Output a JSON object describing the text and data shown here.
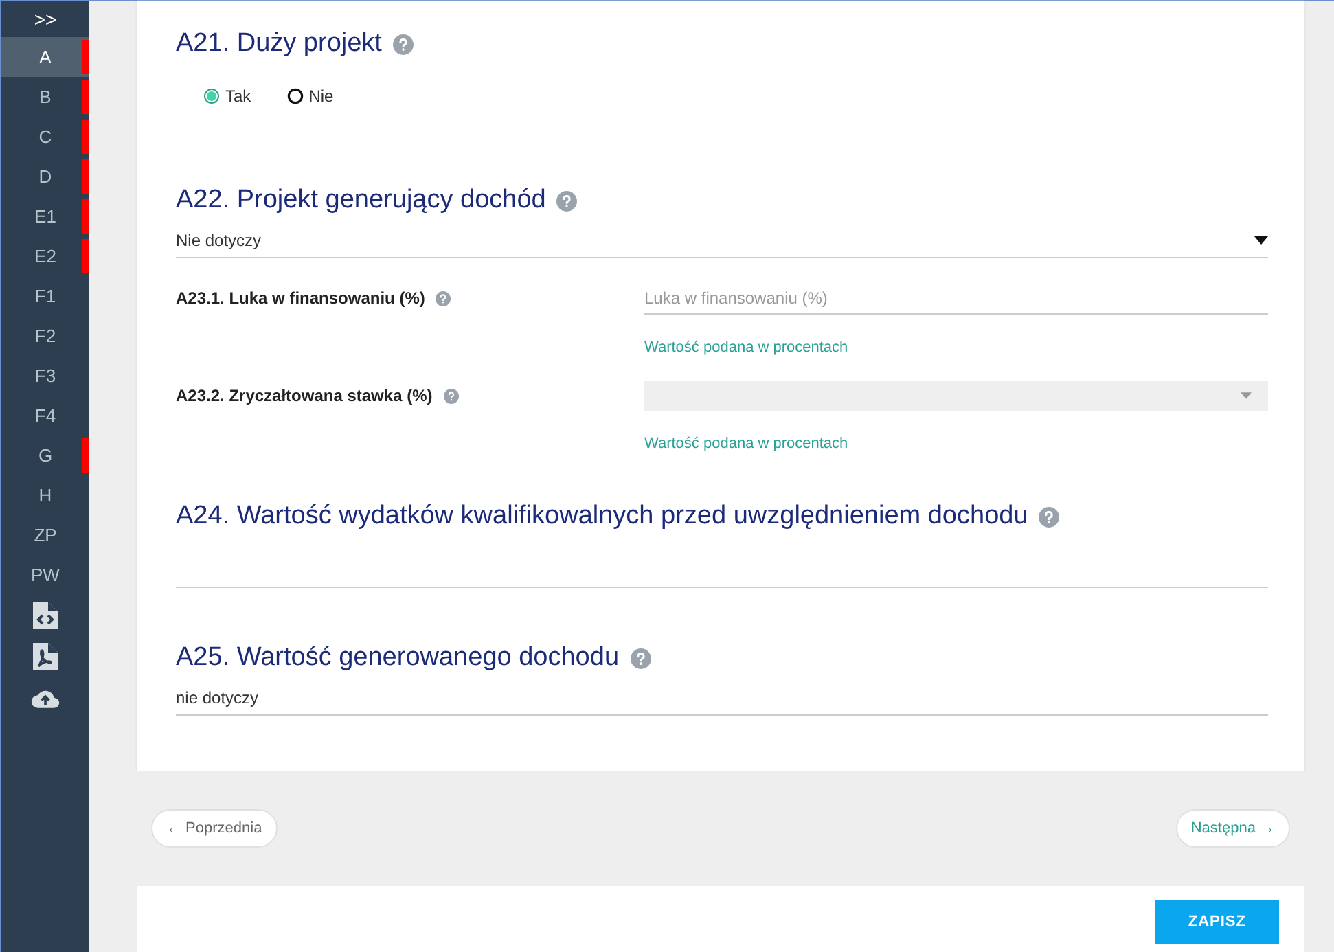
{
  "sidebar": {
    "toggle": ">>",
    "items": [
      {
        "label": "A",
        "selected": true,
        "flagged": true
      },
      {
        "label": "B",
        "selected": false,
        "flagged": true
      },
      {
        "label": "C",
        "selected": false,
        "flagged": true
      },
      {
        "label": "D",
        "selected": false,
        "flagged": true
      },
      {
        "label": "E1",
        "selected": false,
        "flagged": true
      },
      {
        "label": "E2",
        "selected": false,
        "flagged": true
      },
      {
        "label": "F1",
        "selected": false,
        "flagged": false
      },
      {
        "label": "F2",
        "selected": false,
        "flagged": false
      },
      {
        "label": "F3",
        "selected": false,
        "flagged": false
      },
      {
        "label": "F4",
        "selected": false,
        "flagged": false
      },
      {
        "label": "G",
        "selected": false,
        "flagged": true
      },
      {
        "label": "H",
        "selected": false,
        "flagged": false
      },
      {
        "label": "ZP",
        "selected": false,
        "flagged": false
      },
      {
        "label": "PW",
        "selected": false,
        "flagged": false
      }
    ]
  },
  "form": [
    {
      "kind": "radios",
      "title": "A21. Duży projekt",
      "options": [
        {
          "label": "Tak",
          "selected": true
        },
        {
          "label": "Nie",
          "selected": false
        }
      ]
    },
    {
      "kind": "select",
      "title": "A22. Projekt generujący dochód",
      "value": "Nie dotyczy"
    },
    {
      "kind": "input_row",
      "label": "A23.1. Luka w finansowaniu (%)",
      "placeholder": "Luka w finansowaniu (%)",
      "hint": "Wartość podana w procentach"
    },
    {
      "kind": "select_row",
      "label": "A23.2. Zryczałtowana stawka (%)",
      "hint": "Wartość podana w procentach"
    },
    {
      "kind": "text",
      "title": "A24. Wartość wydatków kwalifikowalnych przed uwzględnieniem dochodu"
    },
    {
      "kind": "text",
      "title": "A25. Wartość generowanego dochodu",
      "value": "nie dotyczy"
    }
  ],
  "nav": {
    "previous": "← Poprzednia",
    "next": "Następna →"
  },
  "save": "ZAPISZ"
}
